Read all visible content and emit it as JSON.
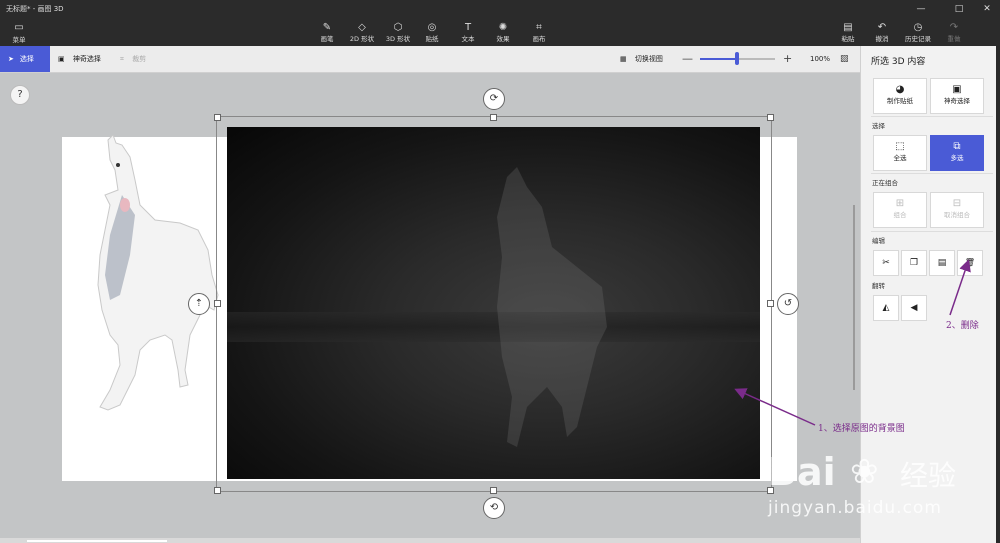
{
  "titlebar": {
    "title": "无标题* - 画图 3D"
  },
  "window_controls": {
    "minimize": "—",
    "maximize": "□",
    "close": "✕"
  },
  "menu": {
    "label": "菜单",
    "icon": "folder-icon"
  },
  "tools": [
    {
      "label": "画笔",
      "icon": "brush-icon",
      "glyph": "✎"
    },
    {
      "label": "2D 形状",
      "icon": "2d-shapes-icon",
      "glyph": "◇"
    },
    {
      "label": "3D 形状",
      "icon": "3d-shapes-icon",
      "glyph": "⬡"
    },
    {
      "label": "贴纸",
      "icon": "sticker-icon",
      "glyph": "◎"
    },
    {
      "label": "文本",
      "icon": "text-icon",
      "glyph": "T"
    },
    {
      "label": "效果",
      "icon": "effects-icon",
      "glyph": "✺"
    },
    {
      "label": "画布",
      "icon": "canvas-icon",
      "glyph": "⌗"
    }
  ],
  "right_tools": [
    {
      "label": "粘贴",
      "icon": "paste-icon",
      "glyph": "▤"
    },
    {
      "label": "撤消",
      "icon": "undo-icon",
      "glyph": "↶"
    },
    {
      "label": "历史记录",
      "icon": "history-icon",
      "glyph": "◷"
    },
    {
      "label": "重做",
      "icon": "redo-icon",
      "glyph": "↷"
    }
  ],
  "toolbar2": {
    "select": "选择",
    "magic_select": "神奇选择",
    "crop": "裁剪",
    "switch_view": "切换视图",
    "zoom_minus": "—",
    "zoom_plus": "+",
    "zoom_value": "100%",
    "zoom_fraction": 0.49
  },
  "help": "?",
  "panel": {
    "title": "所选 3D 内容",
    "top_buttons": [
      {
        "label": "制作贴纸",
        "icon": "make-sticker-icon",
        "glyph": "◕"
      },
      {
        "label": "神奇选择",
        "icon": "magic-select-icon",
        "glyph": "▣"
      }
    ],
    "select_label": "选择",
    "select_buttons": [
      {
        "label": "全选",
        "icon": "select-all-icon",
        "glyph": "⬚",
        "active": false
      },
      {
        "label": "多选",
        "icon": "multi-select-icon",
        "glyph": "⧉",
        "active": true
      }
    ],
    "group_label": "正在组合",
    "group_buttons": [
      {
        "label": "组合",
        "icon": "group-icon",
        "glyph": "⊞"
      },
      {
        "label": "取消组合",
        "icon": "ungroup-icon",
        "glyph": "⊟"
      }
    ],
    "edit_label": "编辑",
    "edit_buttons": [
      {
        "name": "cut",
        "icon": "cut-icon",
        "glyph": "✂"
      },
      {
        "name": "copy",
        "icon": "copy-icon",
        "glyph": "❐"
      },
      {
        "name": "paste",
        "icon": "paste-icon",
        "glyph": "▤"
      },
      {
        "name": "delete",
        "icon": "trash-icon",
        "glyph": "🗑"
      }
    ],
    "flip_label": "翻转",
    "flip_buttons": [
      {
        "name": "flip-horizontal",
        "icon": "flip-horizontal-icon",
        "glyph": "◭"
      },
      {
        "name": "flip-vertical",
        "icon": "flip-vertical-icon",
        "glyph": "◀"
      }
    ]
  },
  "annotations": {
    "step1": "1、选择原图的背景图",
    "step2": "2、删除"
  },
  "watermark": {
    "brand": "Bai",
    "brand_cn": "经验",
    "url": "jingyan.baidu.com"
  },
  "colors": {
    "accent": "#4a5bd6",
    "annotation": "#7a2b8a"
  }
}
